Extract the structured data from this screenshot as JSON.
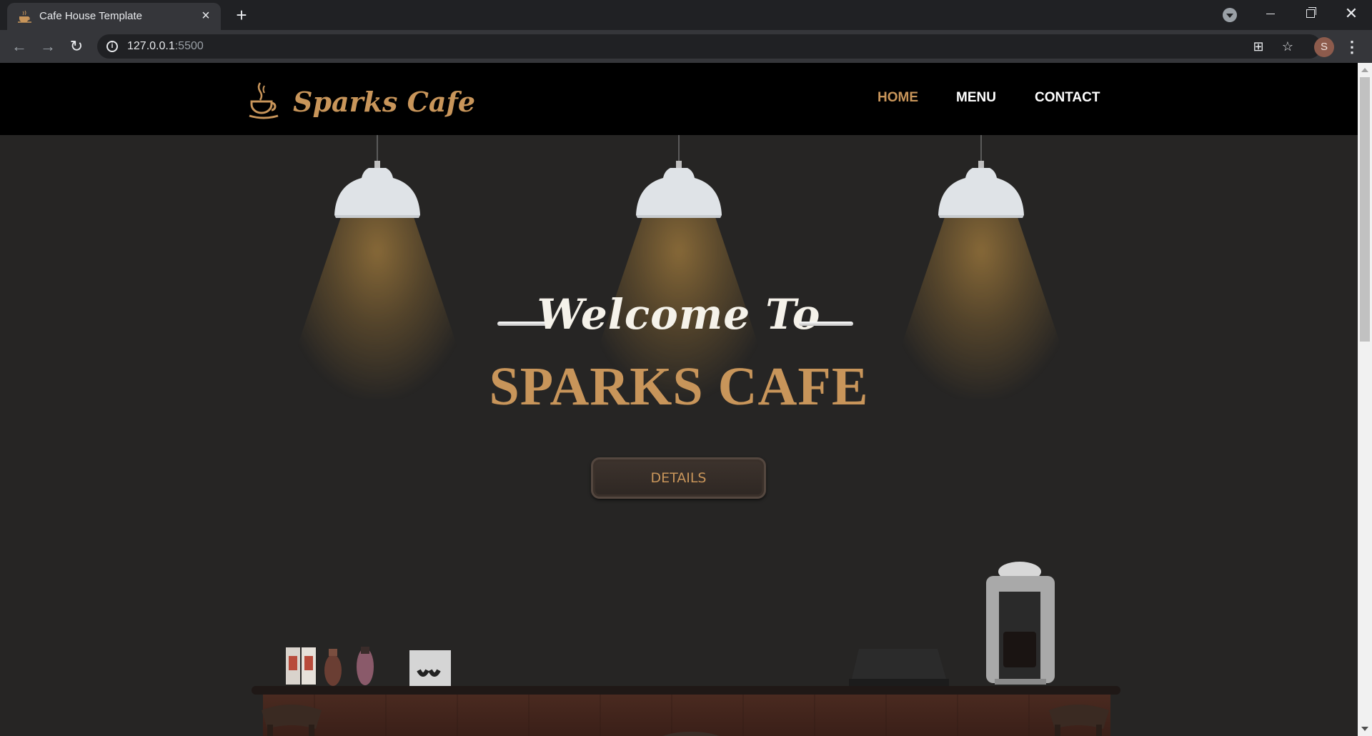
{
  "browser": {
    "tab_title": "Cafe House Template",
    "new_tab_label": "+",
    "url_host": "127.0.0.1",
    "url_port": ":5500",
    "profile_initial": "S"
  },
  "site": {
    "logo_text": "Sparks Cafe",
    "nav": {
      "home": "HOME",
      "menu": "MENU",
      "contact": "CONTACT"
    },
    "hero": {
      "welcome": "Welcome To",
      "title": "SPARKS CAFE",
      "button": "DETAILS"
    }
  },
  "colors": {
    "accent": "#c8955a",
    "header_bg": "#000000",
    "hero_bg": "#262524"
  }
}
